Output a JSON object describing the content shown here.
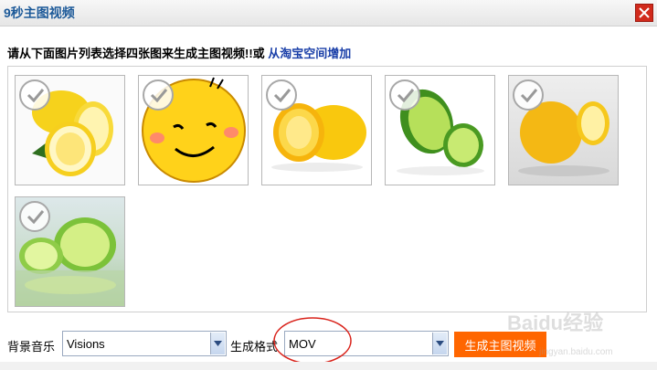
{
  "dialog": {
    "title": "9秒主图视频"
  },
  "instruction": {
    "text": "请从下面图片列表选择四张图来生成主图视频!!或 ",
    "link": "从淘宝空间增加"
  },
  "thumbnails": [
    {
      "name": "lemons-halves"
    },
    {
      "name": "smiley-face"
    },
    {
      "name": "lemon-slice"
    },
    {
      "name": "lime-halves"
    },
    {
      "name": "lemon-on-table"
    },
    {
      "name": "limes-reflection"
    }
  ],
  "controls": {
    "music_label": "背景音乐",
    "music_value": "Visions",
    "format_label": "生成格式",
    "format_value": "MOV",
    "generate_label": "生成主图视频"
  },
  "watermark": {
    "text": "Baidu经验",
    "sub": "jingyan.baidu.com"
  },
  "colors": {
    "accent": "#ff6600",
    "title": "#1d5a99",
    "link": "#1a3fa8",
    "close": "#d12a1c"
  }
}
